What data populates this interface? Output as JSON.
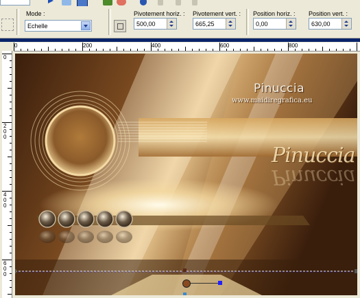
{
  "toolbar": {
    "mode": {
      "label": "Mode :",
      "value": "Echelle"
    },
    "pivot_h": {
      "label": "Pivotement horiz. :",
      "value": "500,00"
    },
    "pivot_v": {
      "label": "Pivotement vert. :",
      "value": "665,25"
    },
    "pos_h": {
      "label": "Position horiz. :",
      "value": "0,00"
    },
    "pos_v": {
      "label": "Position vert. :",
      "value": "630,00"
    }
  },
  "ruler": {
    "h_labels": [
      "0",
      "200",
      "400",
      "600",
      "800"
    ],
    "v_labels": [
      "0",
      "2 0 0",
      "4 0 0",
      "6 0 0"
    ]
  },
  "artwork": {
    "watermark_name": "Pinuccia",
    "watermark_url": "www.maidiregrafica.eu",
    "signature": "Pinuccia"
  },
  "colors": {
    "selection_blue": "#0a246a",
    "brown_dark": "#3a1e0c",
    "gold": "#d9a25a",
    "cream": "#fff6dc"
  }
}
